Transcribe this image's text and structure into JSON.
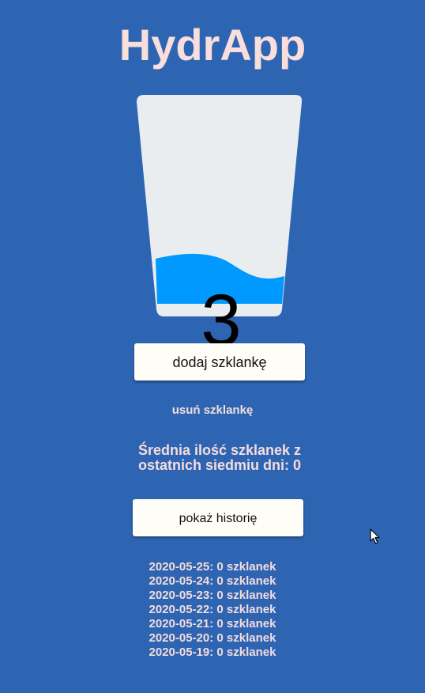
{
  "app": {
    "title": "HydrApp"
  },
  "glass": {
    "count": "3",
    "fill_fraction": 0.3,
    "water_color": "#0099ff",
    "glass_color": "#e9edf0"
  },
  "actions": {
    "add_label": "dodaj szklankę",
    "remove_label": "usuń szklankę",
    "history_label": "pokaż historię"
  },
  "stats": {
    "average_text": "Średnia ilość szklanek z ostatnich siedmiu dni: 0"
  },
  "history": [
    "2020-05-25: 0 szklanek",
    "2020-05-24: 0 szklanek",
    "2020-05-23: 0 szklanek",
    "2020-05-22: 0 szklanek",
    "2020-05-21: 0 szklanek",
    "2020-05-20: 0 szklanek",
    "2020-05-19: 0 szklanek"
  ],
  "colors": {
    "background": "#2e65b3",
    "title": "#f9dedc",
    "text": "#f5dcdc",
    "button": "#fffdf7"
  }
}
